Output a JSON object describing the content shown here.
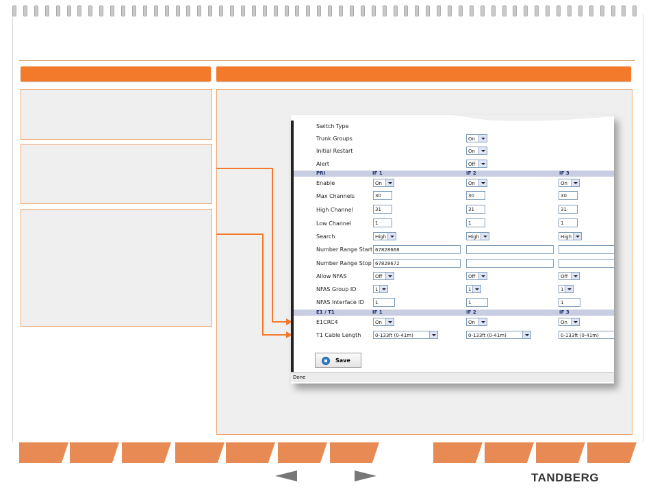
{
  "screen": {
    "rows": {
      "switch_type": "Switch Type",
      "trunk_groups": "Trunk Groups",
      "initial_restart": "Initial Restart",
      "alert": "Alert",
      "enable": "Enable",
      "max_channels": "Max Channels",
      "high_channel": "High Channel",
      "low_channel": "Low Channel",
      "search": "Search",
      "number_range_start": "Number Range Start",
      "number_range_stop": "Number Range Stop",
      "allow_nfas": "Allow NFAS",
      "nfas_group_id": "NFAS Group ID",
      "nfas_interface_id": "NFAS Interface ID",
      "e1crc4": "E1CRC4",
      "t1_cable_length": "T1 Cable Length"
    },
    "sections": {
      "pri": "PRI",
      "e1t1": "E1 / T1",
      "if1": "IF 1",
      "if2": "IF 2",
      "if3": "IF 3"
    },
    "values": {
      "on": "On",
      "off": "Off",
      "max30": "30",
      "high31": "31",
      "low1": "1",
      "high": "High",
      "range_start": "67828668",
      "range_stop": "67828672",
      "one": "1",
      "cable": "0-133ft (0-41m)"
    },
    "save_label": "Save",
    "status": "Done"
  },
  "brand": {
    "logo_text": "TANDBERG",
    "accent": "#f47a2b"
  }
}
